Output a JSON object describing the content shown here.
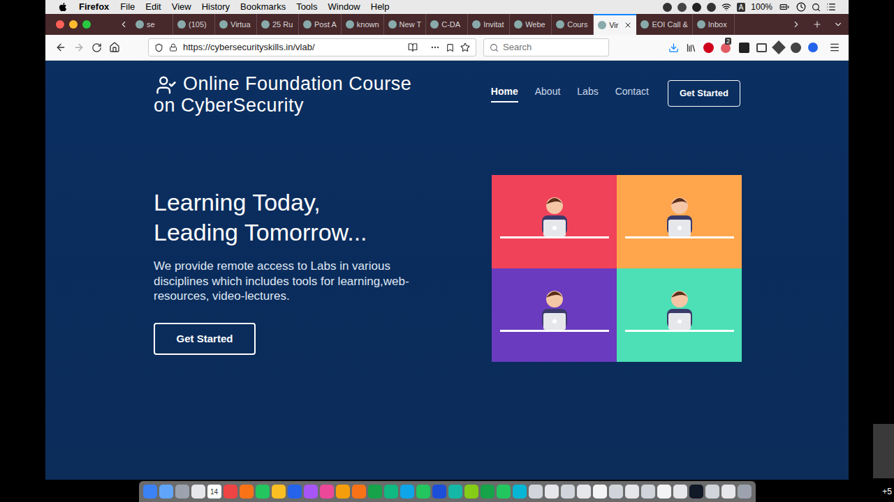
{
  "browser": {
    "app_menu": "Firefox",
    "menus": [
      "File",
      "Edit",
      "View",
      "History",
      "Bookmarks",
      "Tools",
      "Window",
      "Help"
    ],
    "status": {
      "input": "A",
      "battery": "100%"
    }
  },
  "tabs": [
    {
      "label": "se",
      "selected": false
    },
    {
      "label": "(105)",
      "selected": false
    },
    {
      "label": "Virtua",
      "selected": false
    },
    {
      "label": "25 Ru",
      "selected": false
    },
    {
      "label": "Post A",
      "selected": false
    },
    {
      "label": "known",
      "selected": false
    },
    {
      "label": "New T",
      "selected": false
    },
    {
      "label": "C-DA",
      "selected": false
    },
    {
      "label": "Invitat",
      "selected": false
    },
    {
      "label": "Webe",
      "selected": false
    },
    {
      "label": "Cours",
      "selected": false
    },
    {
      "label": "Vir",
      "selected": true
    },
    {
      "label": "EOI Call &",
      "selected": false
    },
    {
      "label": "Inbox",
      "selected": false
    }
  ],
  "address_bar": {
    "url": "https://cybersecurityskills.in/vlab/",
    "search_placeholder": "Search",
    "badge": "2"
  },
  "site": {
    "logo_lines": [
      "Online Foundation Course",
      "on CyberSecurity"
    ],
    "nav": [
      {
        "label": "Home",
        "selected": true
      },
      {
        "label": "About",
        "selected": false
      },
      {
        "label": "Labs",
        "selected": false
      },
      {
        "label": "Contact",
        "selected": false
      }
    ],
    "cta": "Get Started",
    "hero": {
      "headline": [
        "Learning Today,",
        "Leading Tomorrow..."
      ],
      "text": "We provide remote access to Labs in various disciplines which includes tools for learning,web-resources, video-lectures.",
      "button": "Get Started"
    },
    "tiles": [
      {
        "color": "#f0435a"
      },
      {
        "color": "#ffa64d"
      },
      {
        "color": "#6a3bbf"
      },
      {
        "color": "#4ddfb5"
      }
    ]
  },
  "dock": {
    "calendar_day": "14"
  },
  "overflow_count": "+5"
}
